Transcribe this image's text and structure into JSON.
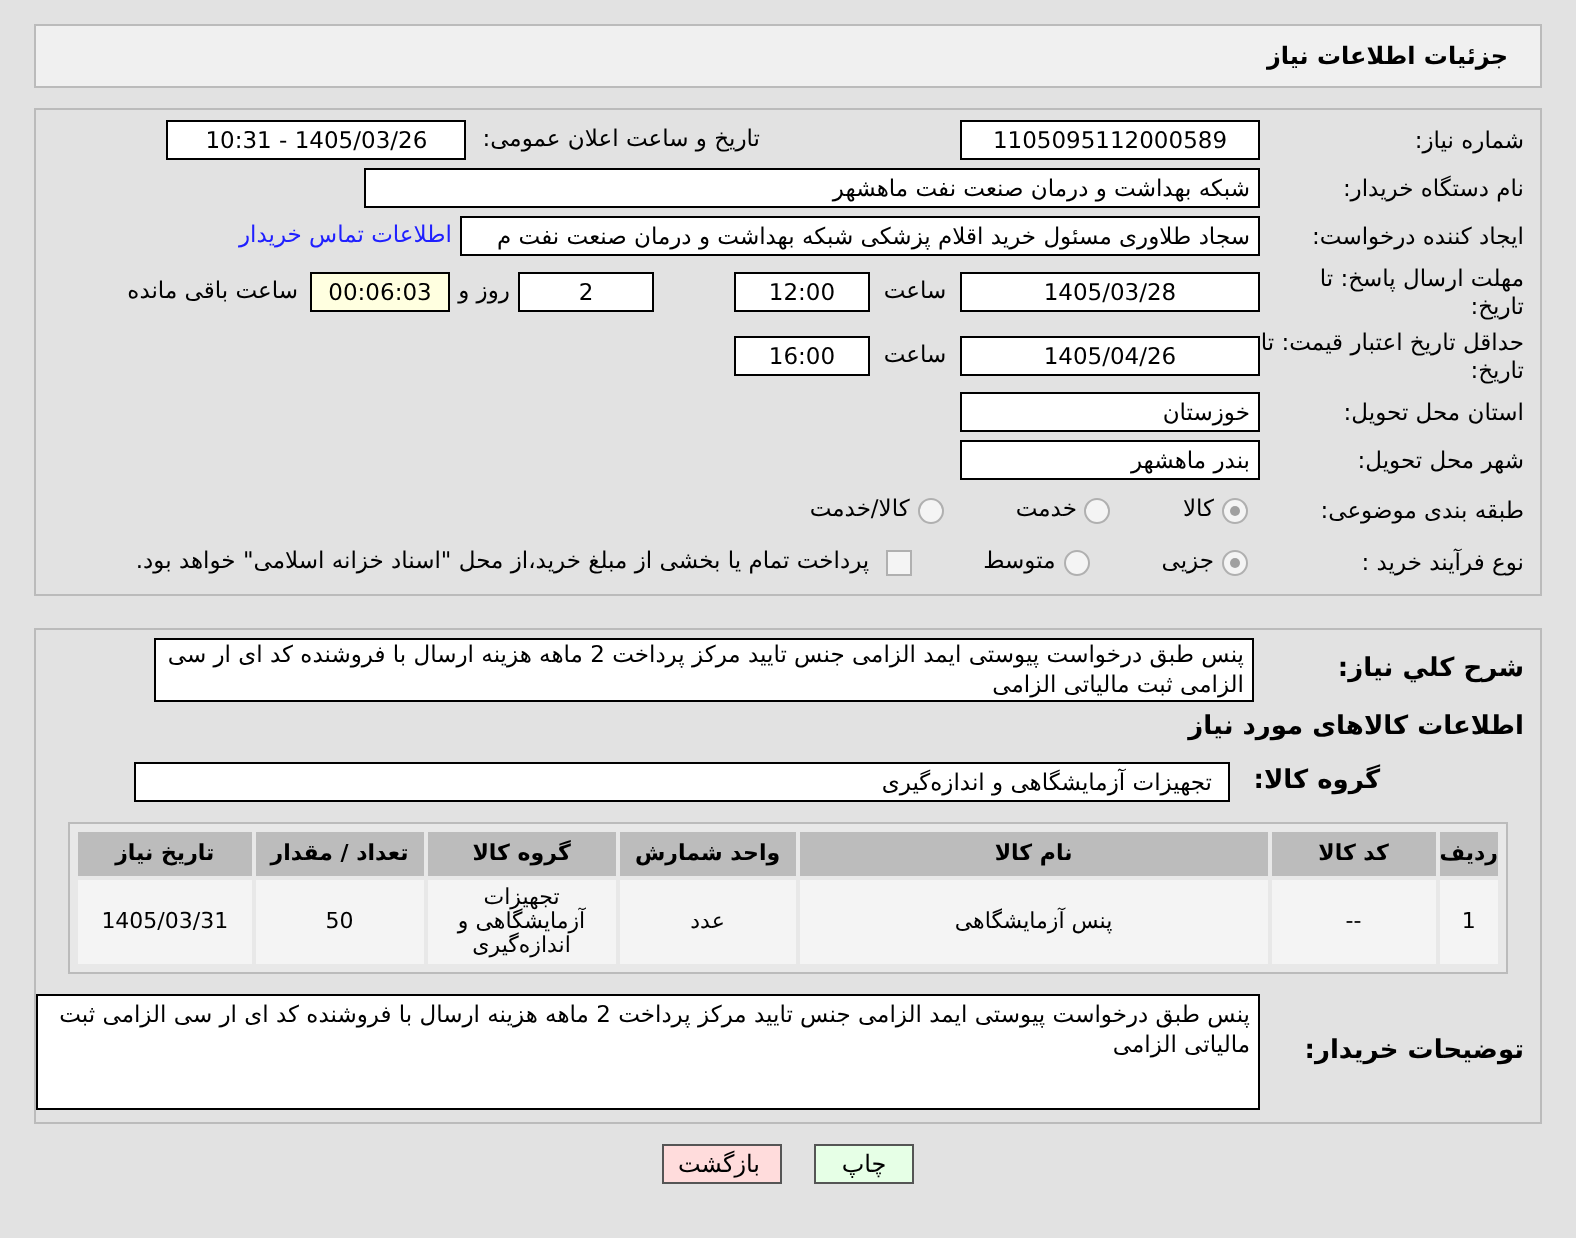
{
  "title": "جزئیات اطلاعات نیاز",
  "need_number": {
    "label": "شماره نیاز:",
    "value": "1105095112000589"
  },
  "announce": {
    "label": "تاریخ و ساعت اعلان عمومی:",
    "value": "1405/03/26 - 10:31"
  },
  "buyer_org": {
    "label": "نام دستگاه خریدار:",
    "value": "شبکه بهداشت و درمان صنعت نفت ماهشهر"
  },
  "requester": {
    "label": "ایجاد کننده درخواست:",
    "value": "سجاد طلاوری مسئول خرید اقلام پزشکی شبکه بهداشت و درمان صنعت نفت م",
    "link": "اطلاعات تماس خریدار"
  },
  "deadline": {
    "label": "مهلت ارسال پاسخ: تا تاریخ:",
    "date": "1405/03/28",
    "time_label": "ساعت",
    "time": "12:00",
    "days": "2",
    "days_label": "روز و",
    "remaining": "00:06:03",
    "remaining_label": "ساعت باقی مانده"
  },
  "validity": {
    "label": "حداقل تاریخ اعتبار قیمت: تا تاریخ:",
    "date": "1405/04/26",
    "time_label": "ساعت",
    "time": "16:00"
  },
  "province": {
    "label": "استان محل تحویل:",
    "value": "خوزستان"
  },
  "city": {
    "label": "شهر محل تحویل:",
    "value": "بندر ماهشهر"
  },
  "category": {
    "label": "طبقه بندی موضوعی:",
    "options": [
      {
        "label": "کالا",
        "selected": true
      },
      {
        "label": "خدمت",
        "selected": false
      },
      {
        "label": "کالا/خدمت",
        "selected": false
      }
    ]
  },
  "process": {
    "label": "نوع فرآیند خرید :",
    "options": [
      {
        "label": "جزیی",
        "selected": true
      },
      {
        "label": "متوسط",
        "selected": false
      }
    ],
    "payment": {
      "label": "پرداخت تمام یا بخشی از مبلغ خرید،از محل \"اسناد خزانه اسلامی\" خواهد بود.",
      "checked": false
    }
  },
  "description": {
    "label": "شرح كلي نياز:",
    "value": "پنس طبق درخواست پیوستی ایمد الزامی جنس تایید مرکز پرداخت 2 ماهه هزینه ارسال با فروشنده کد ای ار سی الزامی ثبت مالیاتی الزامی"
  },
  "goods_heading": "اطلاعات کالاهای مورد نیاز",
  "goods_group": {
    "label": "گروه کالا:",
    "value": "تجهیزات آزمایشگاهی و اندازه‌گیری"
  },
  "table": {
    "columns": [
      "ردیف",
      "کد کالا",
      "نام کالا",
      "واحد شمارش",
      "گروه کالا",
      "تعداد / مقدار",
      "تاریخ نیاز"
    ],
    "rows": [
      [
        "1",
        "--",
        "پنس آزمایشگاهی",
        "عدد",
        "تجهیزات آزمایشگاهی و اندازه‌گیری",
        "50",
        "1405/03/31"
      ]
    ]
  },
  "buyer_notes": {
    "label": "توضیحات خریدار:",
    "value": "پنس طبق درخواست پیوستی ایمد الزامی جنس تایید مرکز پرداخت 2 ماهه هزینه ارسال با فروشنده کد ای ار سی الزامی ثبت مالیاتی الزامی"
  },
  "buttons": [
    {
      "label": "چاپ",
      "kind": "print"
    },
    {
      "label": "بازگشت",
      "kind": "back"
    }
  ]
}
